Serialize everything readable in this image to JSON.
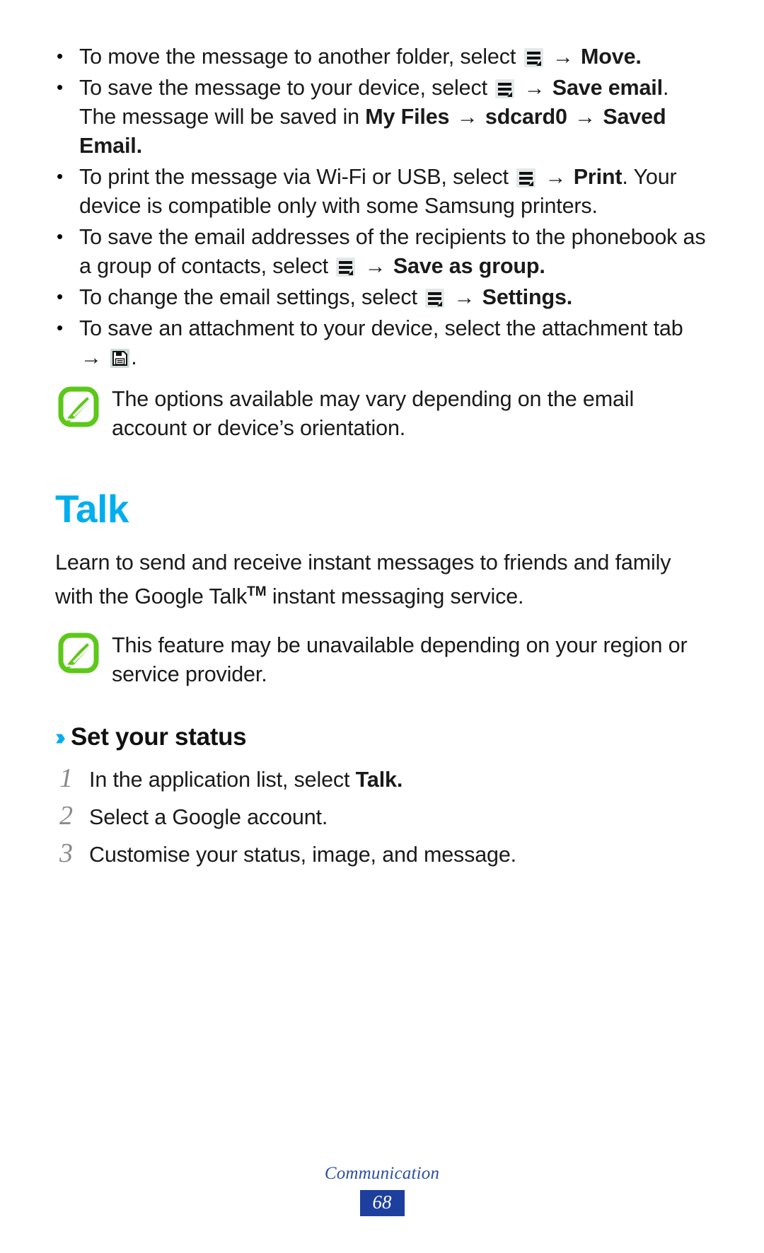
{
  "document": {
    "title": "Talk",
    "accent_color": "#00AEEF",
    "note_icon_color": "#5CC818",
    "footer_box_color": "#1D3F9E"
  },
  "bullets": [
    {
      "pre": "To move the message to another folder, select",
      "icon": "menu-icon",
      "arrow": "→",
      "bold1": "Move",
      "post": "."
    },
    {
      "pre": "To save the message to your device, select",
      "icon": "menu-icon",
      "arrow": "→",
      "bold1": "Save email",
      "mid": ". The message will be saved in",
      "bold2": "My Files",
      "arrow2": "→",
      "bold3": "sdcard0",
      "arrow3": "→",
      "bold4": "Saved Email",
      "post": "."
    },
    {
      "pre": "To print the message via Wi-Fi or USB, select",
      "icon": "menu-icon",
      "arrow": "→",
      "bold1": "Print",
      "post": ". Your device is compatible only with some Samsung printers."
    },
    {
      "pre": "To save the email addresses of the recipients to the phonebook as a group of contacts, select",
      "icon": "menu-icon",
      "arrow": "→",
      "bold1": "Save as group",
      "post": "."
    },
    {
      "pre": "To change the email settings, select",
      "icon": "menu-icon",
      "arrow": "→",
      "bold1": "Settings",
      "post": "."
    },
    {
      "pre": "To save an attachment to your device, select the attachment tab",
      "icon": "save-icon",
      "arrow": "→",
      "bold1": "",
      "post": "."
    }
  ],
  "notes": [
    {
      "text": "The options available may vary depending on the email account or device’s orientation."
    },
    {
      "text": "This feature may be unavailable depending on your region or service provider."
    }
  ],
  "intro": {
    "part1": "Learn to send and receive instant messages to friends and family with the Google Talk",
    "tm": "TM",
    "part2": " instant messaging service."
  },
  "subheading": {
    "marker": "››",
    "label": "Set your status"
  },
  "steps": [
    {
      "num": "1",
      "pre": "In the application list, select ",
      "bold": "Talk",
      "post": "."
    },
    {
      "num": "2",
      "pre": "Select a Google account.",
      "bold": "",
      "post": ""
    },
    {
      "num": "3",
      "pre": "Customise your status, image, and message.",
      "bold": "",
      "post": ""
    }
  ],
  "footer": {
    "section": "Communication",
    "page_number": "68"
  }
}
